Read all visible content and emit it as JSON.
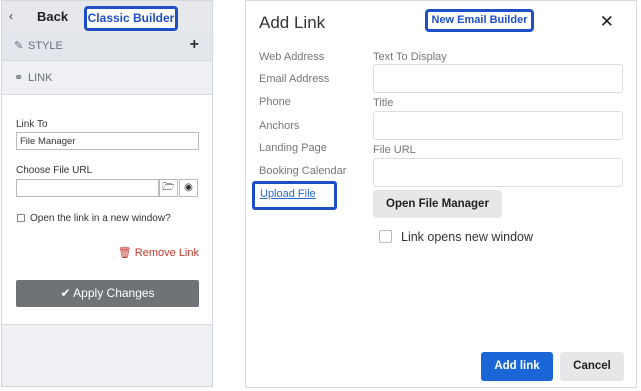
{
  "classic": {
    "back_label": "Back",
    "builder_label": "Classic Builder",
    "style_label": "STYLE",
    "link_label": "LINK",
    "link_to_label": "Link To",
    "link_to_value": "File Manager",
    "choose_file_label": "Choose File URL",
    "choose_file_value": "",
    "new_window_label": "Open the link in a new window?",
    "remove_link_label": "Remove Link",
    "apply_label": "Apply Changes"
  },
  "dialog": {
    "title": "Add Link",
    "builder_label": "New Email Builder",
    "nav": [
      "Web Address",
      "Email Address",
      "Phone",
      "Anchors",
      "Landing Page",
      "Booking Calendar"
    ],
    "nav_selected": "Upload File",
    "text_to_display_label": "Text To Display",
    "title_label": "Title",
    "file_url_label": "File URL",
    "open_file_manager_label": "Open File Manager",
    "new_window_label": "Link opens new window",
    "add_link_label": "Add link",
    "cancel_label": "Cancel"
  },
  "colors": {
    "highlight": "#1f4fc4",
    "primary": "#1a66d6",
    "remove": "#c0392b"
  }
}
